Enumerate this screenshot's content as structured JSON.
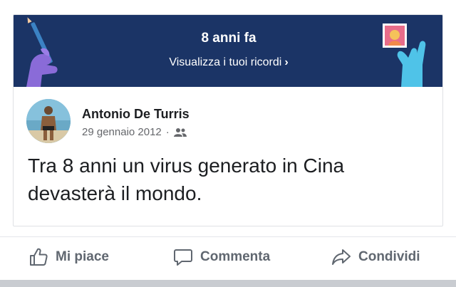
{
  "memory": {
    "title": "8 anni fa",
    "link_label": "Visualizza i tuoi ricordi",
    "chevron": "›",
    "background": "#1b3466"
  },
  "post": {
    "author": "Antonio De Turris",
    "date": "29 gennaio 2012",
    "separator": "·",
    "audience_icon": "friends-icon",
    "text": "Tra 8 anni un virus generato in Cina devasterà il mondo."
  },
  "actions": {
    "like_label": "Mi piace",
    "comment_label": "Commenta",
    "share_label": "Condividi",
    "like_icon": "thumbs-up-icon",
    "comment_icon": "comment-icon",
    "share_icon": "share-icon"
  },
  "colors": {
    "text": "#1c1e21",
    "secondary": "#65676b",
    "action": "#606770"
  }
}
